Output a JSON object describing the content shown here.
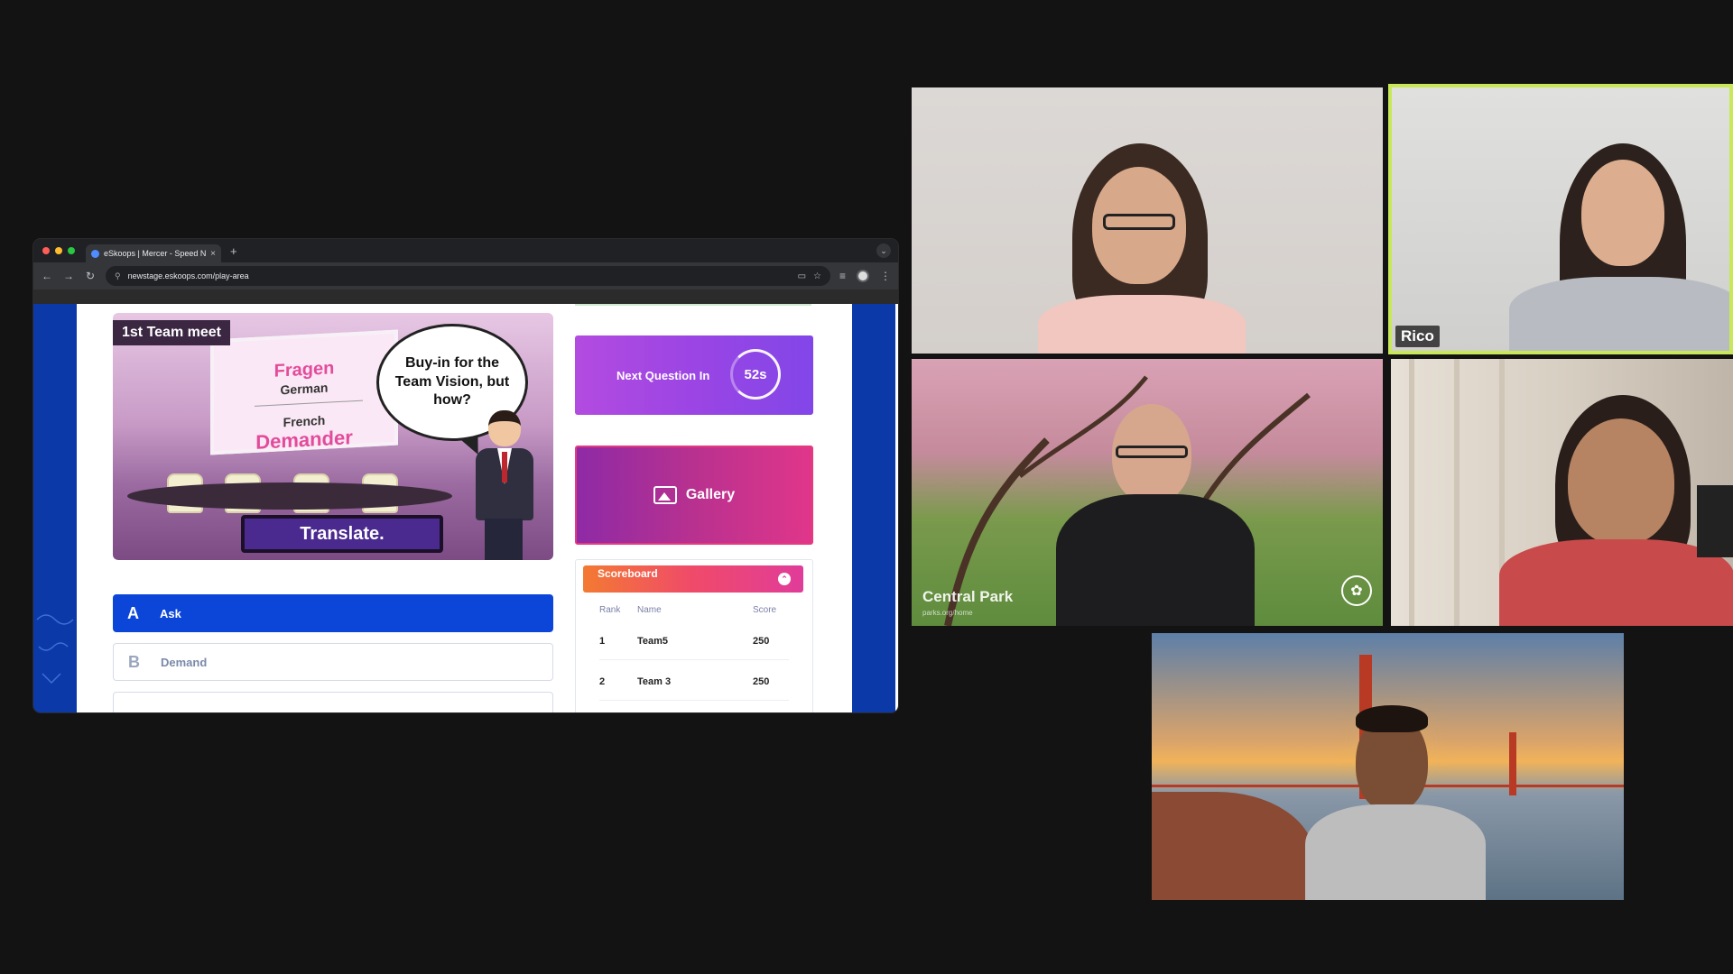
{
  "browser": {
    "tab_title": "eSkoops | Mercer - Speed Ne",
    "tab_close": "×",
    "new_tab": "+",
    "tab_menu": "⌄",
    "url": "newstage.eskoops.com/play-area"
  },
  "scene": {
    "label": "1st Team meet",
    "board_word_top": "Fragen",
    "board_lang_top": "German",
    "board_lang_bottom": "French",
    "board_word_bottom": "Demander",
    "speech_bubble": "Buy-in for the Team Vision, but how?",
    "translate_button": "Translate."
  },
  "options": [
    {
      "letter": "A",
      "text": "Ask"
    },
    {
      "letter": "B",
      "text": "Demand"
    }
  ],
  "next_question": {
    "label": "Next Question In",
    "timer": "52s"
  },
  "gallery": {
    "label": "Gallery"
  },
  "scoreboard": {
    "title": "Scoreboard",
    "toggle": "⌃",
    "columns": {
      "rank": "Rank",
      "name": "Name",
      "score": "Score"
    },
    "rows": [
      {
        "rank": "1",
        "name": "Team5",
        "score": "250"
      },
      {
        "rank": "2",
        "name": "Team 3",
        "score": "250"
      }
    ]
  },
  "participants": {
    "p2_name": "Rico",
    "p3_background_label": "Central Park",
    "p3_background_sub": "parks.org/home"
  },
  "colors": {
    "active_speaker_border": "#c8e85a",
    "option_selected": "#0b46d9",
    "page_sidebar": "#0b3aa8"
  }
}
